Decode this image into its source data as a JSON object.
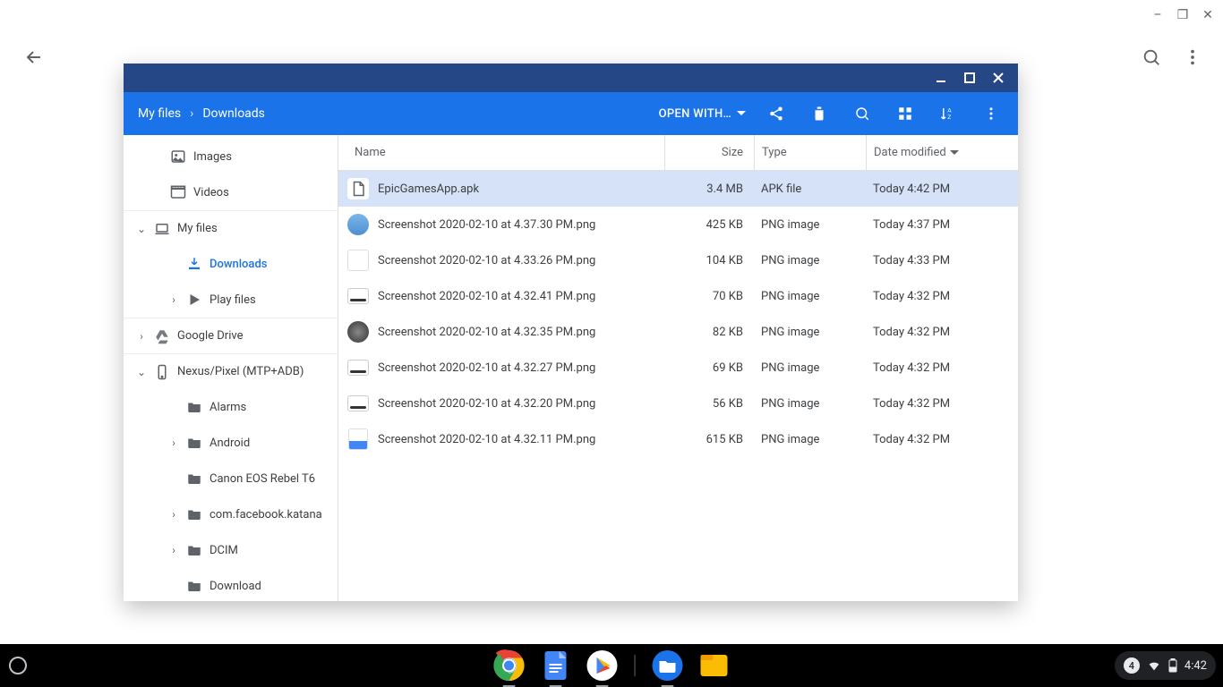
{
  "window_controls": {
    "minimize": "–",
    "maximize": "❐",
    "close": "✕"
  },
  "browser_top": {
    "back": "←",
    "search": "search",
    "menu": "⋮"
  },
  "files_window": {
    "titlebar": {
      "minimize": "–",
      "maximize": "▢",
      "close": "✕"
    },
    "breadcrumb": [
      "My files",
      "Downloads"
    ],
    "open_with_label": "OPEN WITH…",
    "columns": {
      "name": "Name",
      "size": "Size",
      "type": "Type",
      "date": "Date modified"
    },
    "sidebar": [
      {
        "label": "Images",
        "indent": 1,
        "icon": "image",
        "expand": ""
      },
      {
        "label": "Videos",
        "indent": 1,
        "icon": "video",
        "expand": ""
      },
      {
        "label": "My files",
        "indent": 0,
        "icon": "laptop",
        "expand": "v",
        "divider": true
      },
      {
        "label": "Downloads",
        "indent": 2,
        "icon": "download",
        "expand": "",
        "active": true
      },
      {
        "label": "Play files",
        "indent": 2,
        "icon": "play",
        "expand": ">"
      },
      {
        "label": "Google Drive",
        "indent": 0,
        "icon": "drive",
        "expand": ">",
        "divider": true
      },
      {
        "label": "Nexus/Pixel (MTP+ADB)",
        "indent": 0,
        "icon": "phone",
        "expand": "v",
        "divider": true
      },
      {
        "label": "Alarms",
        "indent": 2,
        "icon": "folder",
        "expand": ""
      },
      {
        "label": "Android",
        "indent": 2,
        "icon": "folder",
        "expand": ">"
      },
      {
        "label": "Canon EOS Rebel T6",
        "indent": 2,
        "icon": "folder",
        "expand": ""
      },
      {
        "label": "com.facebook.katana",
        "indent": 2,
        "icon": "folder",
        "expand": ">"
      },
      {
        "label": "DCIM",
        "indent": 2,
        "icon": "folder",
        "expand": ">"
      },
      {
        "label": "Download",
        "indent": 2,
        "icon": "folder",
        "expand": ""
      }
    ],
    "files": [
      {
        "name": "EpicGamesApp.apk",
        "size": "3.4 MB",
        "type": "APK file",
        "date": "Today 4:42 PM",
        "icon": "file",
        "selected": true
      },
      {
        "name": "Screenshot 2020-02-10 at 4.37.30 PM.png",
        "size": "425 KB",
        "type": "PNG image",
        "date": "Today 4:37 PM",
        "icon": "thumb1"
      },
      {
        "name": "Screenshot 2020-02-10 at 4.33.26 PM.png",
        "size": "104 KB",
        "type": "PNG image",
        "date": "Today 4:33 PM",
        "icon": "thumb2"
      },
      {
        "name": "Screenshot 2020-02-10 at 4.32.41 PM.png",
        "size": "70 KB",
        "type": "PNG image",
        "date": "Today 4:32 PM",
        "icon": "thumb3"
      },
      {
        "name": "Screenshot 2020-02-10 at 4.32.35 PM.png",
        "size": "82 KB",
        "type": "PNG image",
        "date": "Today 4:32 PM",
        "icon": "thumb4"
      },
      {
        "name": "Screenshot 2020-02-10 at 4.32.27 PM.png",
        "size": "69 KB",
        "type": "PNG image",
        "date": "Today 4:32 PM",
        "icon": "thumb3"
      },
      {
        "name": "Screenshot 2020-02-10 at 4.32.20 PM.png",
        "size": "56 KB",
        "type": "PNG image",
        "date": "Today 4:32 PM",
        "icon": "thumb3"
      },
      {
        "name": "Screenshot 2020-02-10 at 4.32.11 PM.png",
        "size": "615 KB",
        "type": "PNG image",
        "date": "Today 4:32 PM",
        "icon": "thumb5"
      }
    ]
  },
  "shelf": {
    "apps": [
      "chrome",
      "docs",
      "play",
      "files",
      "files-yellow"
    ],
    "tray": {
      "notifications": "4",
      "time": "4:42"
    }
  }
}
